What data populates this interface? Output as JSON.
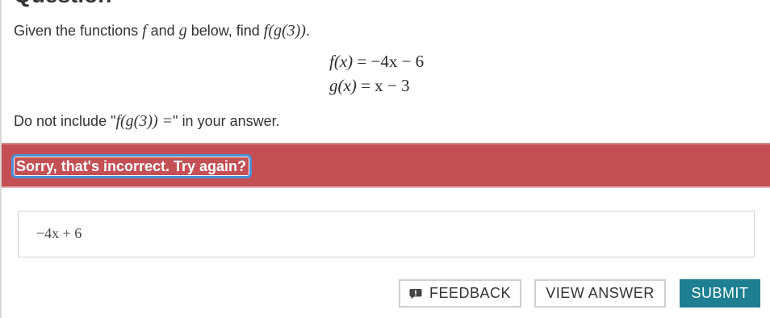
{
  "header": {
    "title_partial": "Question"
  },
  "prompt": {
    "lead": "Given the functions ",
    "f": "f",
    "and": " and ",
    "g": "g",
    "mid": " below, find ",
    "target": "f(g(3))",
    "end": "."
  },
  "equations": [
    {
      "lhs": "f(x)",
      "rhs": " = −4x − 6"
    },
    {
      "lhs": "g(x)",
      "rhs": " = x − 3"
    }
  ],
  "note": {
    "lead": "Do not include \"",
    "expr": "f(g(3)) =",
    "end": "\" in your answer."
  },
  "banner": {
    "message": "Sorry, that's incorrect. Try again?",
    "color": "#c44f55"
  },
  "answer": {
    "value": "−4x + 6"
  },
  "buttons": {
    "feedback": "FEEDBACK",
    "view_answer": "VIEW ANSWER",
    "submit": "SUBMIT"
  },
  "colors": {
    "submit": "#1e7f93",
    "focus_ring": "#4a90d9"
  },
  "icons": {
    "feedback": "feedback-bubble-icon"
  }
}
